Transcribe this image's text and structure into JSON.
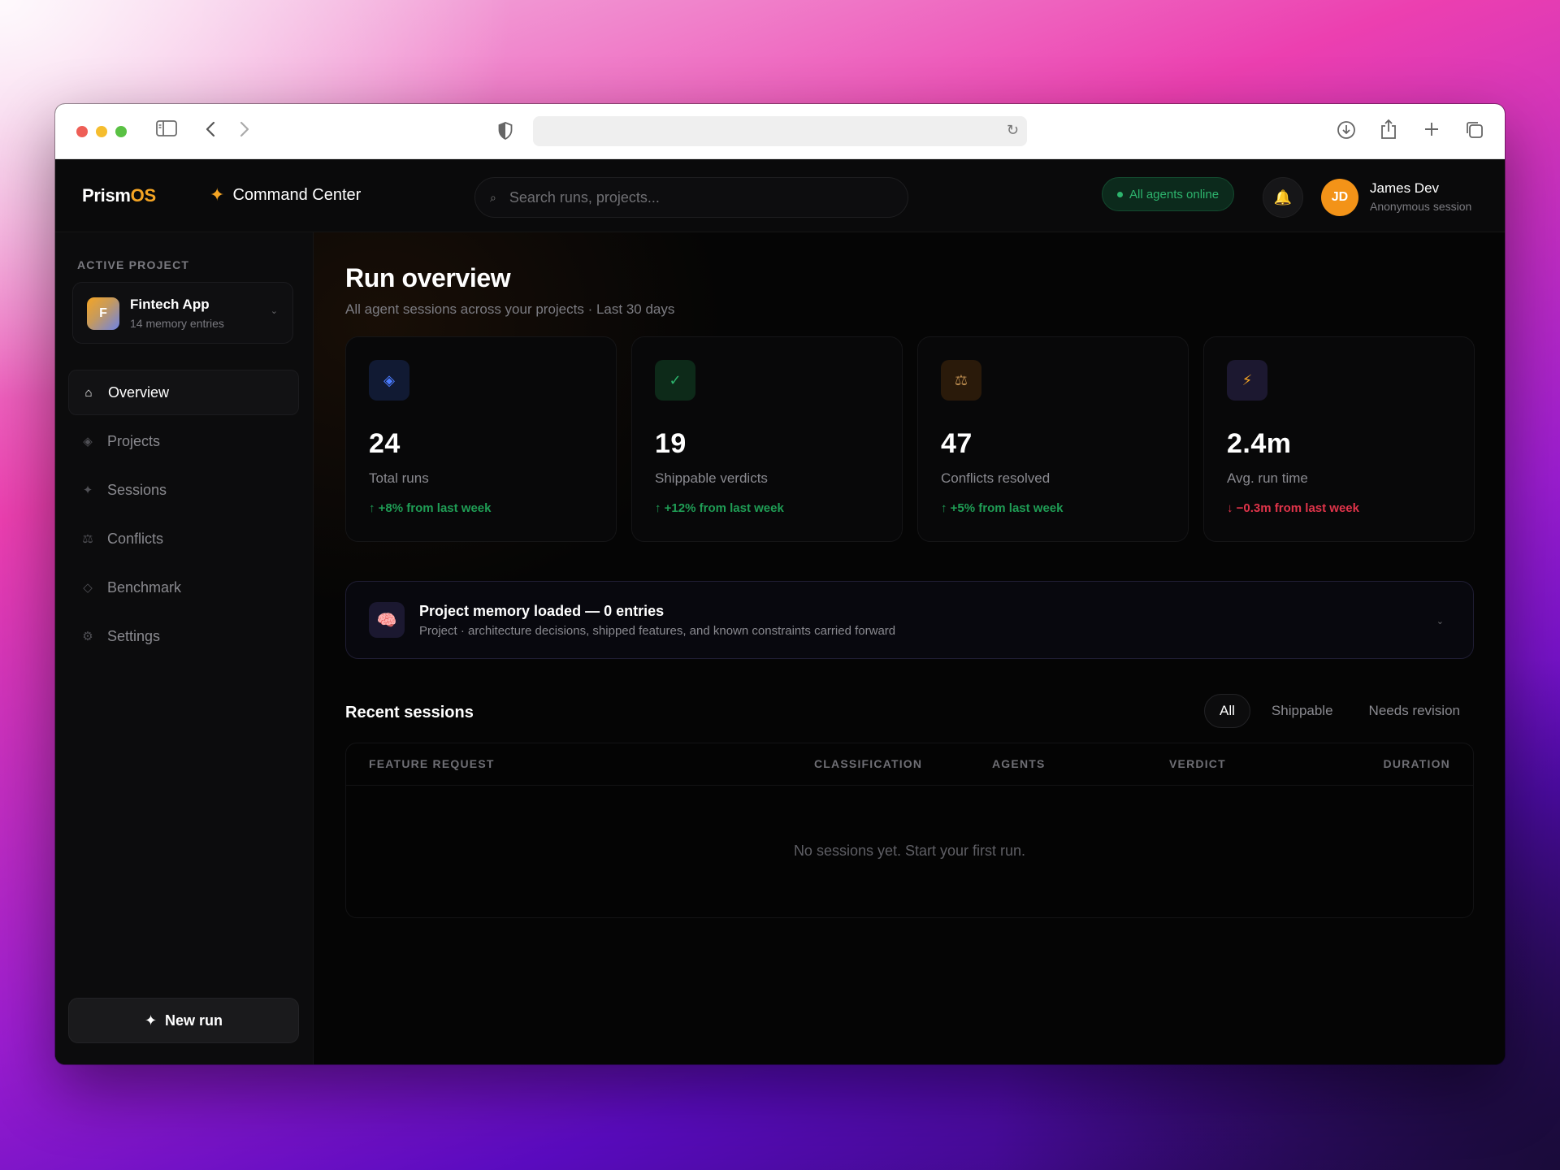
{
  "browser": {
    "url": ""
  },
  "header": {
    "logo_main": "Prism",
    "logo_accent": "OS",
    "section_title": "Command Center",
    "search_placeholder": "Search runs, projects...",
    "status_badge": "All agents online",
    "user": {
      "initials": "JD",
      "name": "James Dev",
      "subtitle": "Anonymous session"
    }
  },
  "sidebar": {
    "section_label": "ACTIVE PROJECT",
    "project": {
      "initial": "F",
      "name": "Fintech App",
      "subtitle": "14 memory entries"
    },
    "nav": [
      {
        "label": "Overview",
        "icon": "home-icon",
        "active": true
      },
      {
        "label": "Projects",
        "icon": "diamond-icon",
        "active": false
      },
      {
        "label": "Sessions",
        "icon": "sparkle-icon",
        "active": false
      },
      {
        "label": "Conflicts",
        "icon": "scale-icon",
        "active": false
      },
      {
        "label": "Benchmark",
        "icon": "diamond-outline-icon",
        "active": false
      },
      {
        "label": "Settings",
        "icon": "gear-icon",
        "active": false
      }
    ],
    "new_run_label": "New run"
  },
  "main": {
    "title": "Run overview",
    "subtitle": "All agent sessions across your projects · Last 30 days",
    "stats": [
      {
        "icon": "diamond-icon",
        "value": "24",
        "label": "Total runs",
        "delta": "↑ +8% from last week",
        "trend": "up"
      },
      {
        "icon": "check-icon",
        "value": "19",
        "label": "Shippable verdicts",
        "delta": "↑ +12% from last week",
        "trend": "up"
      },
      {
        "icon": "scale-icon",
        "value": "47",
        "label": "Conflicts resolved",
        "delta": "↑ +5% from last week",
        "trend": "up"
      },
      {
        "icon": "lightning-icon",
        "value": "2.4m",
        "label": "Avg. run time",
        "delta": "↓ −0.3m from last week",
        "trend": "down"
      }
    ],
    "memory": {
      "title": "Project memory loaded — 0 entries",
      "subtitle": "Project · architecture decisions, shipped features, and known constraints carried forward"
    },
    "recent": {
      "title": "Recent sessions",
      "filters": [
        "All",
        "Shippable",
        "Needs revision"
      ],
      "active_filter": "All",
      "columns": [
        "FEATURE REQUEST",
        "CLASSIFICATION",
        "AGENTS",
        "VERDICT",
        "DURATION"
      ],
      "empty_message": "No sessions yet. Start your first run."
    }
  },
  "colors": {
    "accent": "#f5a524",
    "positive": "#1f9d55",
    "negative": "#e0344a",
    "online": "#2db46d"
  }
}
